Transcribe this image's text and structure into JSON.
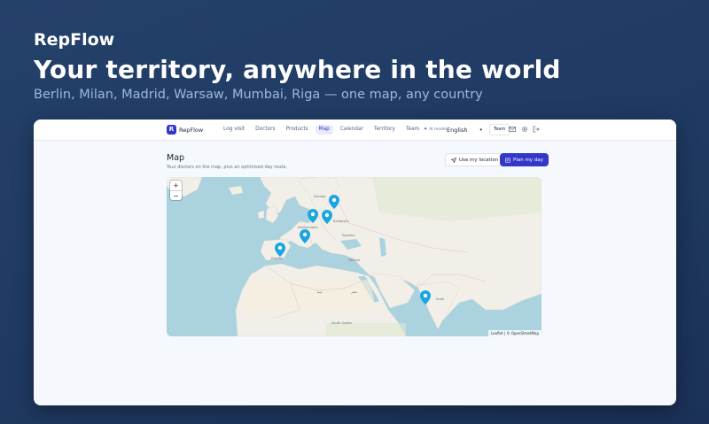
{
  "hero": {
    "brand": "RepFlow",
    "headline": "Your territory, anywhere in the world",
    "subline": "Berlin, Milan, Madrid, Warsaw, Mumbai, Riga — one map, any country"
  },
  "app": {
    "logo_letter": "R",
    "logo_text": "RepFlow",
    "nav": [
      {
        "label": "Log visit",
        "active": false
      },
      {
        "label": "Doctors",
        "active": false
      },
      {
        "label": "Products",
        "active": false
      },
      {
        "label": "Map",
        "active": true
      },
      {
        "label": "Calendar",
        "active": false
      },
      {
        "label": "Territory",
        "active": false
      },
      {
        "label": "Team",
        "active": false
      }
    ],
    "ai_badge": "AI model",
    "language": "English",
    "team_button": "Team",
    "icons": [
      "mail-icon",
      "gear-icon",
      "logout-icon"
    ]
  },
  "page": {
    "title": "Map",
    "subtitle": "Your doctors on the map, plus an optimised day route.",
    "use_location_label": "Use my location",
    "plan_day_label": "Plan my day"
  },
  "map": {
    "zoom_in": "+",
    "zoom_out": "−",
    "attribution": "Leaflet | © OpenStreetMap",
    "labels": [
      "Deutschland",
      "España",
      "Україна",
      "India",
      "Türkiye",
      "Беларусь",
      "Sverige",
      "ليبيا",
      "مصر",
      "South Sudan"
    ]
  },
  "colors": {
    "accent": "#3338c9",
    "pin": "#1aa6e0",
    "water": "#aad3df",
    "land": "#f2efe9"
  }
}
